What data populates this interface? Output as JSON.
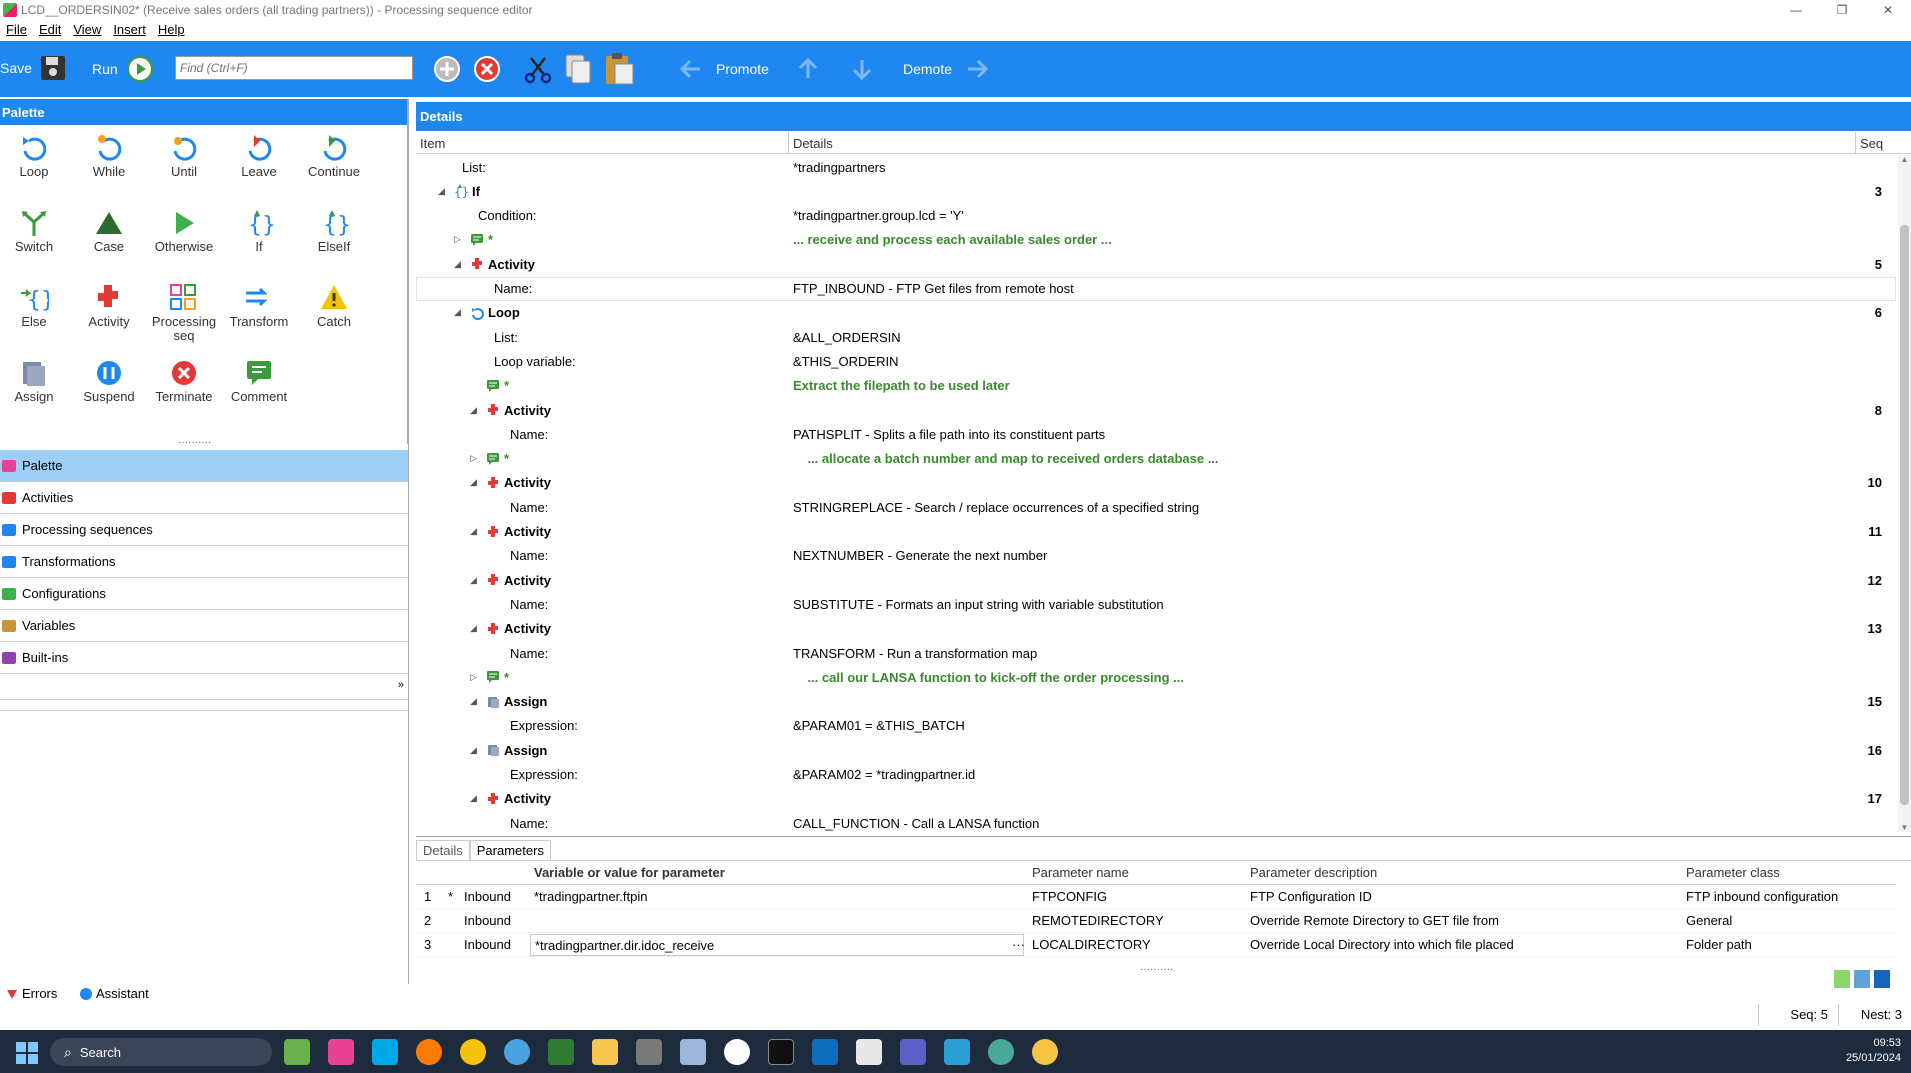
{
  "window": {
    "title": "LCD__ORDERSIN02* (Receive sales orders (all trading partners)) - Processing sequence editor",
    "minimize": "—",
    "restore": "❐",
    "close": "✕"
  },
  "menu": [
    "File",
    "Edit",
    "View",
    "Insert",
    "Help"
  ],
  "toolbar": {
    "save": "Save",
    "run": "Run",
    "find_placeholder": "Find (Ctrl+F)",
    "promote": "Promote",
    "demote": "Demote",
    "color": "#1e88f0"
  },
  "palette": {
    "title": "Palette",
    "items": [
      {
        "label": "Loop",
        "icon": "loop-icon"
      },
      {
        "label": "While",
        "icon": "while-icon"
      },
      {
        "label": "Until",
        "icon": "until-icon"
      },
      {
        "label": "Leave",
        "icon": "leave-icon"
      },
      {
        "label": "Continue",
        "icon": "continue-icon"
      },
      {
        "label": "Switch",
        "icon": "switch-icon"
      },
      {
        "label": "Case",
        "icon": "case-icon"
      },
      {
        "label": "Otherwise",
        "icon": "otherwise-icon"
      },
      {
        "label": "If",
        "icon": "if-icon"
      },
      {
        "label": "ElseIf",
        "icon": "elseif-icon"
      },
      {
        "label": "Else",
        "icon": "else-icon"
      },
      {
        "label": "Activity",
        "icon": "activity-icon"
      },
      {
        "label": "Processing seq",
        "icon": "processing-seq-icon"
      },
      {
        "label": "Transform",
        "icon": "transform-icon"
      },
      {
        "label": "Catch",
        "icon": "catch-icon"
      },
      {
        "label": "Assign",
        "icon": "assign-icon"
      },
      {
        "label": "Suspend",
        "icon": "suspend-icon"
      },
      {
        "label": "Terminate",
        "icon": "terminate-icon"
      },
      {
        "label": "Comment",
        "icon": "comment-icon"
      }
    ]
  },
  "nav": [
    {
      "label": "Palette",
      "selected": true
    },
    {
      "label": "Activities"
    },
    {
      "label": "Processing sequences"
    },
    {
      "label": "Transformations"
    },
    {
      "label": "Configurations"
    },
    {
      "label": "Variables"
    },
    {
      "label": "Built-ins"
    }
  ],
  "details": {
    "title": "Details",
    "columns": {
      "item": "Item",
      "details": "Details",
      "seq": "Seq"
    },
    "rows": [
      {
        "indent": 0,
        "label": "List:",
        "details": "*tradingpartners"
      },
      {
        "indent": 0,
        "twist": "◢",
        "icon": "if",
        "label": "If",
        "bold": true,
        "seq": "3"
      },
      {
        "indent": 1,
        "label": "Condition:",
        "details": "*tradingpartner.group.lcd = 'Y'"
      },
      {
        "indent": 1,
        "twist": "▷",
        "icon": "comment",
        "label": "*",
        "details": "... receive and process each available sales order ...",
        "comment": true
      },
      {
        "indent": 1,
        "twist": "◢",
        "icon": "activity",
        "label": "Activity",
        "bold": true,
        "seq": "5"
      },
      {
        "indent": 2,
        "label": "Name:",
        "details": "FTP_INBOUND - FTP Get files from remote host",
        "boxed": true
      },
      {
        "indent": 1,
        "twist": "◢",
        "icon": "loop",
        "label": "Loop",
        "bold": true,
        "seq": "6"
      },
      {
        "indent": 2,
        "label": "List:",
        "details": "&ALL_ORDERSIN"
      },
      {
        "indent": 2,
        "label": "Loop variable:",
        "details": "&THIS_ORDERIN"
      },
      {
        "indent": 2,
        "icon": "comment",
        "label": "*",
        "details": "Extract the filepath to be used later",
        "comment": true
      },
      {
        "indent": 2,
        "twist": "◢",
        "icon": "activity",
        "label": "Activity",
        "bold": true,
        "seq": "8"
      },
      {
        "indent": 3,
        "label": "Name:",
        "details": "PATHSPLIT - Splits a file path into its constituent parts"
      },
      {
        "indent": 2,
        "twist": "▷",
        "icon": "comment",
        "label": "*",
        "details": "    ... allocate a batch number and map to received orders database ...",
        "comment": true
      },
      {
        "indent": 2,
        "twist": "◢",
        "icon": "activity",
        "label": "Activity",
        "bold": true,
        "seq": "10"
      },
      {
        "indent": 3,
        "label": "Name:",
        "details": "STRINGREPLACE - Search / replace occurrences of a specified string"
      },
      {
        "indent": 2,
        "twist": "◢",
        "icon": "activity",
        "label": "Activity",
        "bold": true,
        "seq": "11"
      },
      {
        "indent": 3,
        "label": "Name:",
        "details": "NEXTNUMBER - Generate the next number"
      },
      {
        "indent": 2,
        "twist": "◢",
        "icon": "activity",
        "label": "Activity",
        "bold": true,
        "seq": "12"
      },
      {
        "indent": 3,
        "label": "Name:",
        "details": "SUBSTITUTE - Formats an input string with variable substitution"
      },
      {
        "indent": 2,
        "twist": "◢",
        "icon": "activity",
        "label": "Activity",
        "bold": true,
        "seq": "13"
      },
      {
        "indent": 3,
        "label": "Name:",
        "details": "TRANSFORM - Run a transformation map"
      },
      {
        "indent": 2,
        "twist": "▷",
        "icon": "comment",
        "label": "*",
        "details": "    ... call our LANSA function to kick-off the order processing ...",
        "comment": true
      },
      {
        "indent": 2,
        "twist": "◢",
        "icon": "assign",
        "label": "Assign",
        "bold": true,
        "seq": "15"
      },
      {
        "indent": 3,
        "label": "Expression:",
        "details": "&PARAM01 = &THIS_BATCH"
      },
      {
        "indent": 2,
        "twist": "◢",
        "icon": "assign",
        "label": "Assign",
        "bold": true,
        "seq": "16"
      },
      {
        "indent": 3,
        "label": "Expression:",
        "details": "&PARAM02 = *tradingpartner.id"
      },
      {
        "indent": 2,
        "twist": "◢",
        "icon": "activity",
        "label": "Activity",
        "bold": true,
        "seq": "17"
      },
      {
        "indent": 3,
        "label": "Name:",
        "details": "CALL_FUNCTION - Call a LANSA function"
      }
    ]
  },
  "bottom_tabs": {
    "details": "Details",
    "parameters": "Parameters"
  },
  "params": {
    "columns": {
      "var": "Variable or value for parameter",
      "name": "Parameter name",
      "desc": "Parameter description",
      "cls": "Parameter class"
    },
    "rows": [
      {
        "n": "1",
        "mark": "*",
        "dir": "Inbound",
        "var": "*tradingpartner.ftpin",
        "name": "FTPCONFIG",
        "desc": "FTP Configuration ID",
        "cls": "FTP inbound configuration"
      },
      {
        "n": "2",
        "mark": "",
        "dir": "Inbound",
        "var": "",
        "name": "REMOTEDIRECTORY",
        "desc": "Override Remote Directory to GET file from",
        "cls": "General"
      },
      {
        "n": "3",
        "mark": "",
        "dir": "Inbound",
        "var": "*tradingpartner.dir.idoc_receive",
        "name": "LOCALDIRECTORY",
        "desc": "Override Local Directory into which file placed",
        "cls": "Folder path",
        "ellipsis": "···"
      }
    ]
  },
  "status": {
    "errors": "Errors",
    "assistant": "Assistant",
    "seq": "Seq: 5",
    "nest": "Nest: 3"
  },
  "taskbar": {
    "search": "Search",
    "time": "09:53",
    "date": "25/01/2024"
  }
}
